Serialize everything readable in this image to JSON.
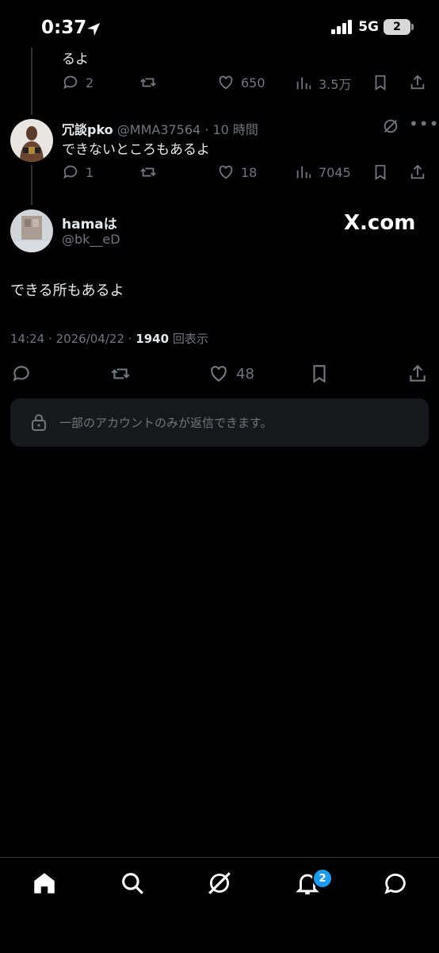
{
  "status_bar": {
    "time": "0:37",
    "network": "5G",
    "battery": "2"
  },
  "tweet_top": {
    "text_tail": "るよ",
    "replies": "2",
    "retweets": "",
    "likes": "650",
    "views": "3.5万"
  },
  "tweet_reply": {
    "name": "冗談pko",
    "handle": "@MMA37564",
    "time": "10 時間",
    "text": "できないところもあるよ",
    "replies": "1",
    "likes": "18",
    "views": "7045"
  },
  "main_tweet": {
    "name": "hamaは",
    "handle": "@bk__eD",
    "watermark": "X.com",
    "text": "できる所もあるよ",
    "timestamp": "14:24 · 2026/04/22 · ",
    "views_count": "1940",
    "views_label": " 回表示",
    "likes": "48",
    "reply_restriction": "一部のアカウントのみが返信できます。"
  },
  "bottom_nav": {
    "notification_badge": "2"
  }
}
